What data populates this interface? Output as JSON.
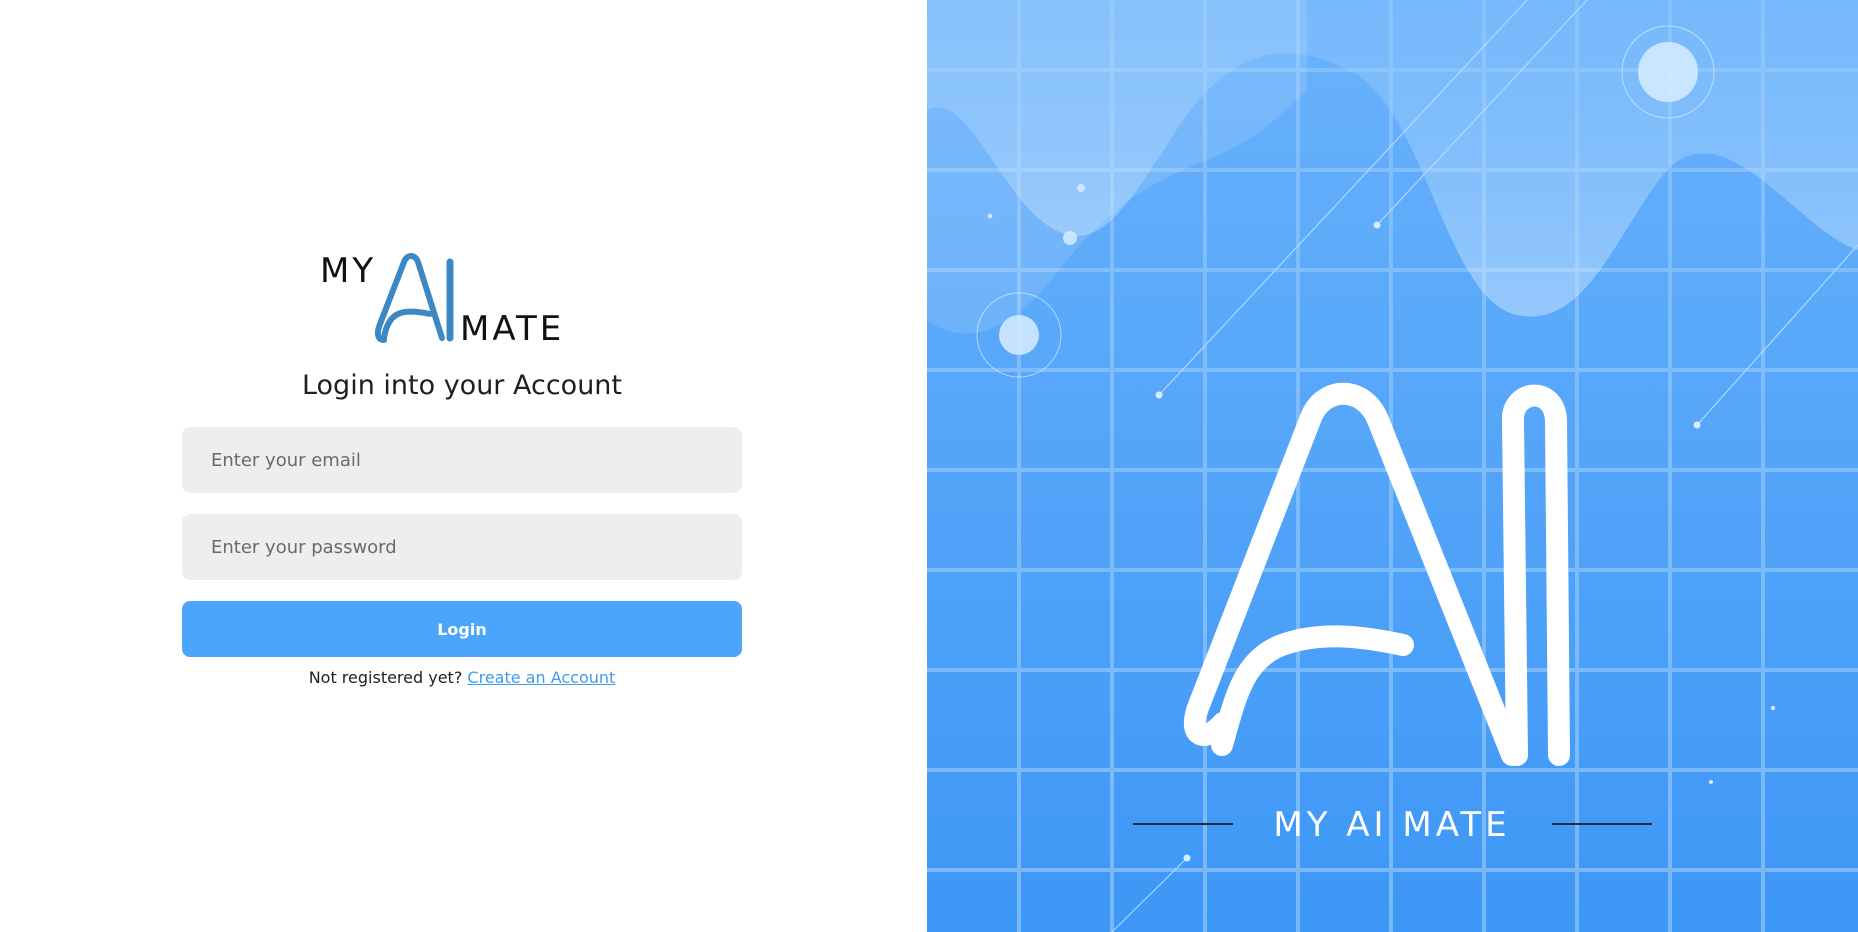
{
  "brand": {
    "logo_top": "MY",
    "logo_mark": "AI",
    "logo_bottom": "MATE",
    "tagline": "MY AI MATE",
    "accent_color": "#4aa5fb",
    "logo_blue": "#3b88c4"
  },
  "login_form": {
    "heading": "Login into your Account",
    "email_placeholder": "Enter your email",
    "password_placeholder": "Enter your password",
    "login_label": "Login",
    "register_prompt": "Not registered yet?",
    "register_link": "Create an Account"
  },
  "hero": {
    "bg_top_color": "#6ab2fc",
    "bg_bottom_color": "#3d97f6",
    "icons": [
      "grid-background",
      "wave-shape",
      "bubble",
      "ai-monogram"
    ]
  }
}
